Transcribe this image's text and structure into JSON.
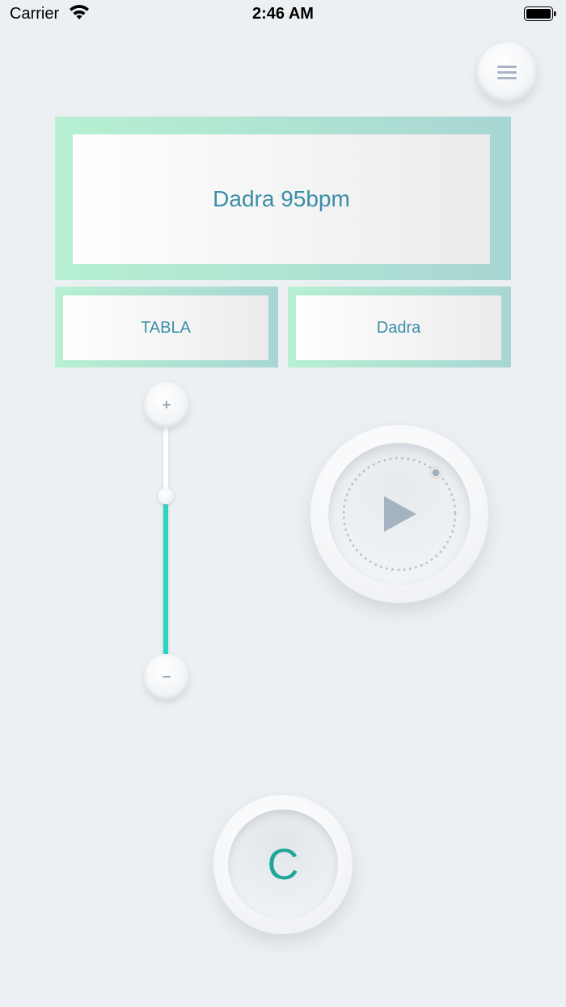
{
  "status_bar": {
    "carrier": "Carrier",
    "time": "2:46 AM",
    "wifi_icon": "wifi-icon",
    "battery_icon": "battery-icon"
  },
  "menu": {
    "icon": "hamburger-menu-icon"
  },
  "display": {
    "rhythm_text": "Dadra 95bpm"
  },
  "selectors": {
    "instrument": "TABLA",
    "taal": "Dadra"
  },
  "tempo_slider": {
    "plus_label": "+",
    "minus_label": "−",
    "level": 0.7,
    "fill_color": "#2dd4c4"
  },
  "play": {
    "icon": "play-icon"
  },
  "key": {
    "label": "C",
    "color": "#1fa89a"
  },
  "colors": {
    "accent_text": "#3b8ea8",
    "frame_gradient_start": "#b7f0d2",
    "frame_gradient_end": "#a8d6d3",
    "background": "#edf0f3"
  }
}
